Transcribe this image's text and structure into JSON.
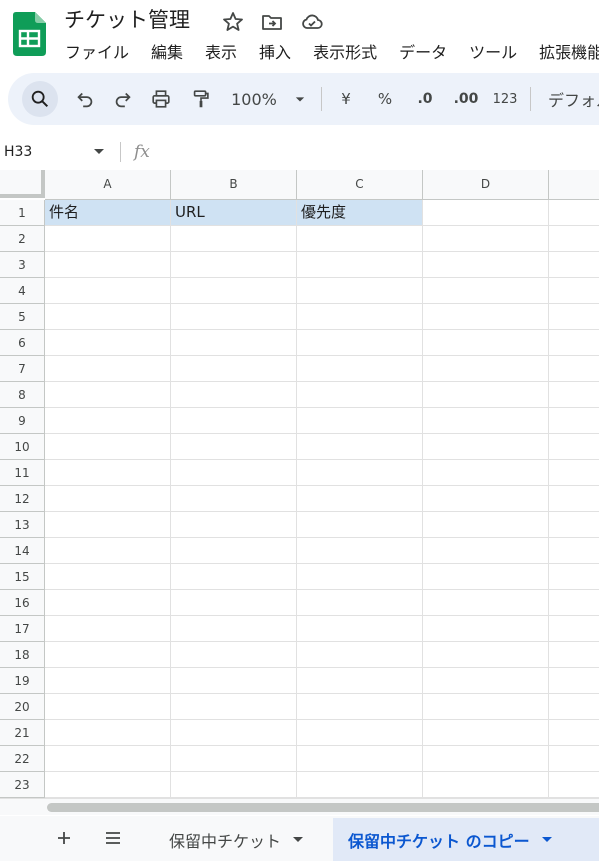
{
  "title": "チケット管理",
  "menu": [
    "ファイル",
    "編集",
    "表示",
    "挿入",
    "表示形式",
    "データ",
    "ツール",
    "拡張機能"
  ],
  "toolbar": {
    "zoom": "100%",
    "currency": "¥",
    "percent": "%",
    "decrease_decimal": ".0",
    "increase_decimal": ".00",
    "number_format": "123",
    "font": "デフォルト"
  },
  "formula_bar": {
    "name_box": "H33",
    "fx_label": "fx"
  },
  "columns": [
    "A",
    "B",
    "C",
    "D"
  ],
  "rows": [
    "1",
    "2",
    "3",
    "4",
    "5",
    "6",
    "7",
    "8",
    "9",
    "10",
    "11",
    "12",
    "13",
    "14",
    "15",
    "16",
    "17",
    "18",
    "19",
    "20",
    "21",
    "22",
    "23"
  ],
  "header_row": [
    "件名",
    "URL",
    "優先度"
  ],
  "sheet_tabs": [
    {
      "label": "保留中チケット",
      "active": false
    },
    {
      "label": "保留中チケット のコピー",
      "active": true
    }
  ],
  "colors": {
    "header_highlight": "#cfe2f3",
    "active_tab_text": "#0b57d0",
    "toolbar_bg": "#edf2fa",
    "sheets_green": "#0f9d58"
  }
}
